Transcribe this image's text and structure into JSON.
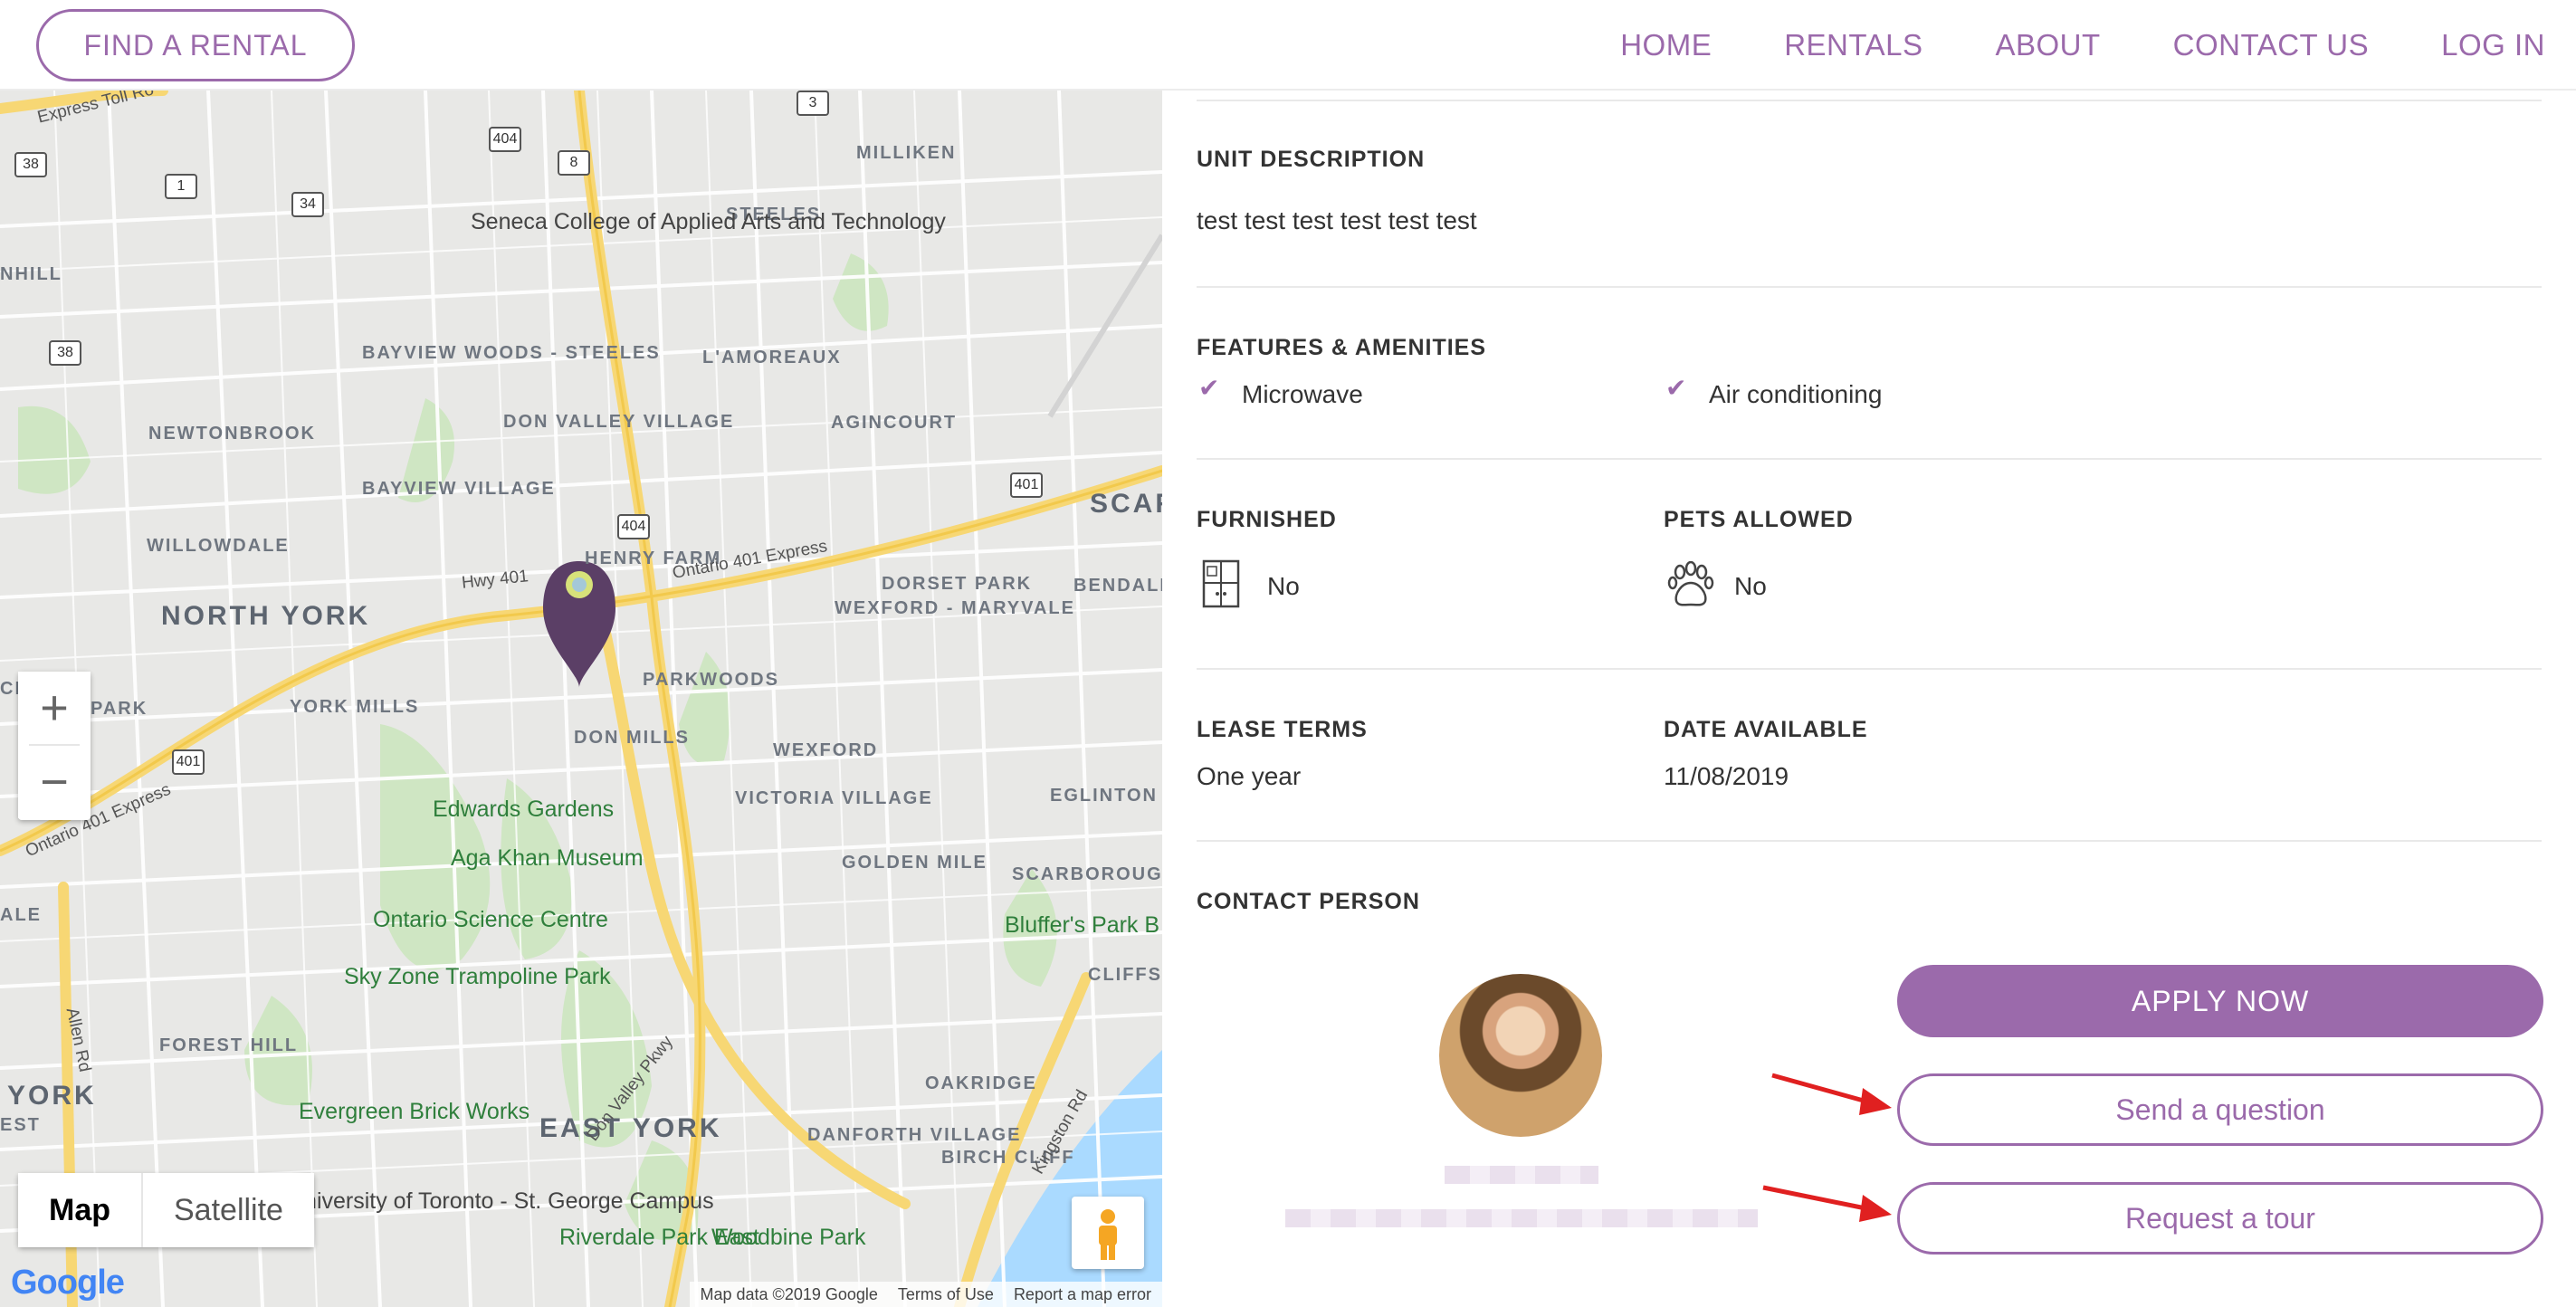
{
  "header": {
    "find_rental_label": "FIND A RENTAL",
    "nav": [
      "HOME",
      "RENTALS",
      "ABOUT",
      "CONTACT US",
      "LOG IN"
    ],
    "accent_color": "#9b6aab"
  },
  "map": {
    "labels": {
      "north_york": "NORTH YORK",
      "east_york": "EAST YORK",
      "york": "YORK",
      "scar": "SCAR",
      "milliken": "MILLIKEN",
      "steeles": "STEELES",
      "lamoreaux": "L'AMOREAUX",
      "agincourt": "AGINCOURT",
      "bayview_woods": "BAYVIEW WOODS - STEELES",
      "newtonbrook": "NEWTONBROOK",
      "don_valley_village": "DON VALLEY VILLAGE",
      "bayview_village": "BAYVIEW VILLAGE",
      "willowdale": "WILLOWDALE",
      "henry_farm": "HENRY FARM",
      "dorset_park": "DORSET PARK",
      "bendale": "BENDALE",
      "wexford_maryvale": "WEXFORD - MARYVALE",
      "parkwoods": "PARKWOODS",
      "york_mills": "YORK MILLS",
      "don_mills": "DON MILLS",
      "wexford": "WEXFORD",
      "eglinton": "EGLINTON E",
      "victoria_village": "VICTORIA VILLAGE",
      "golden_mile": "GOLDEN MILE",
      "scarborough_junction": "SCARBOROUGH JUNCTION",
      "park": "PARK",
      "forest_hill": "FOREST HILL",
      "oakridge": "OAKRIDGE",
      "danforth_village": "DANFORTH VILLAGE",
      "birch_cliff": "BIRCH CLIFF",
      "cliffs": "CLIFFS",
      "nhill": "NHILL",
      "ale": "ALE",
      "est": "EST",
      "cl": "CL"
    },
    "poi": {
      "seneca": "Seneca College of Applied Arts and Technology",
      "edwards_gardens": "Edwards Gardens",
      "aga_khan": "Aga Khan Museum",
      "science_centre": "Ontario Science Centre",
      "sky_zone": "Sky Zone Trampoline Park",
      "evergreen": "Evergreen Brick Works",
      "university": "University of Toronto - St. George Campus",
      "riverdale": "Riverdale Park East",
      "woodbine": "Woodbine Park",
      "bluffers": "Bluffer's Park B"
    },
    "roads": {
      "hwy401": "Hwy 401",
      "ontario401": "Ontario 401 Express",
      "ontario401_sw": "Ontario 401 Express",
      "express_toll": "Express Toll Ro",
      "allen_rd": "Allen Rd",
      "dvp": "Don Valley Pkwy",
      "kingston": "Kingston Rd"
    },
    "shields": [
      "38",
      "1",
      "34",
      "404",
      "8",
      "3",
      "38",
      "401",
      "404",
      "401"
    ],
    "zoom_in": "+",
    "zoom_out": "−",
    "type_map": "Map",
    "type_satellite": "Satellite",
    "logo": "Google",
    "attribution": [
      "Map data ©2019 Google",
      "Terms of Use",
      "Report a map error"
    ]
  },
  "listing": {
    "unit_description_label": "UNIT DESCRIPTION",
    "unit_description": "test test test test test test",
    "features_label": "FEATURES & AMENITIES",
    "features": [
      "Microwave",
      "Air conditioning"
    ],
    "furnished_label": "FURNISHED",
    "furnished_value": "No",
    "pets_label": "PETS ALLOWED",
    "pets_value": "No",
    "lease_label": "LEASE TERMS",
    "lease_value": "One year",
    "date_label": "DATE AVAILABLE",
    "date_value": "11/08/2019",
    "contact_label": "CONTACT PERSON"
  },
  "actions": {
    "apply": "APPLY NOW",
    "question": "Send a question",
    "tour": "Request a tour",
    "arrow_color": "#e02020"
  }
}
